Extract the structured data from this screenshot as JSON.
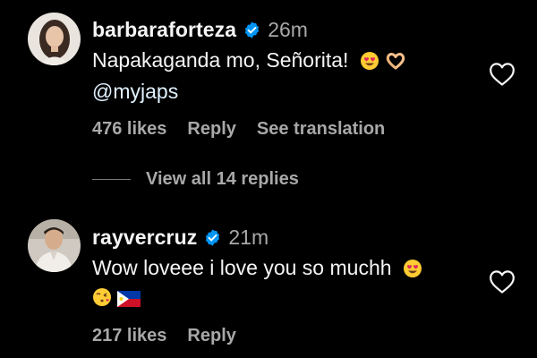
{
  "comments": [
    {
      "username": "barbaraforteza",
      "time": "26m",
      "text_line1": "Napakaganda mo, Señorita!",
      "mention": "@myjaps",
      "likes": "476 likes",
      "reply_label": "Reply",
      "translation_label": "See translation",
      "icons": [
        "verified-badge-icon",
        "heart-eyes-emoji-icon",
        "heart-hands-emoji-icon",
        "heart-outline-icon"
      ]
    },
    {
      "username": "rayvercruz",
      "time": "21m",
      "text_line1": "Wow loveee i love you so muchh",
      "likes": "217 likes",
      "reply_label": "Reply",
      "icons": [
        "verified-badge-icon",
        "heart-eyes-emoji-icon",
        "kiss-emoji-icon",
        "philippines-flag-icon",
        "heart-outline-icon"
      ]
    }
  ],
  "view_replies_label": "View all 14 replies",
  "colors": {
    "background": "#000000",
    "primary_text": "#f5f5f5",
    "secondary_text": "#a8a8a8",
    "verified": "#0095f6"
  }
}
